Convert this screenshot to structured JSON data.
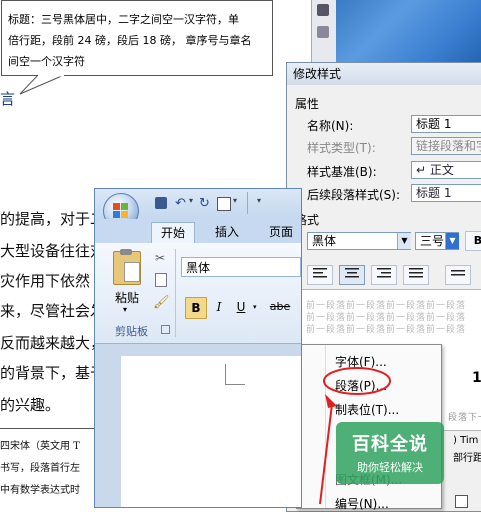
{
  "callout": {
    "line1": "标题：三号黑体居中，二字之间空一汉字符，单",
    "line2": "倍行距，段前 24 磅，段后 18 磅， 章序号与章名",
    "line3": "间空一个汉字符"
  },
  "document": {
    "line_a": "的提高，对于二",
    "line_b": "大型设备往往对",
    "line_c": "灾作用下依然",
    "line_d": "来，尽管社会发",
    "line_e": "反而越来越大，",
    "line_f": "的背景下，基于",
    "line_g": "的兴趣。",
    "small_1": "四宋体（英文用 T",
    "small_2": "书写，段落首行左",
    "small_3": "中有数学表达式时",
    "heading_fragment": "言"
  },
  "modify_dialog": {
    "title": "修改样式",
    "section_properties": "属性",
    "name_label": "名称(N):",
    "name_value": "标题 1",
    "type_label": "样式类型(T):",
    "type_value": "链接段落和字",
    "based_on_label": "样式基准(B):",
    "based_on_value": "↵ 正文",
    "next_label": "后续段落样式(S):",
    "next_value": "标题 1",
    "section_format": "格式",
    "font_value": "黑体",
    "size_value": "三号",
    "bold": "B",
    "preview_text": "前一段落前一段落前一段落前一段落",
    "preview_next": "段落下一",
    "preview_big": "1",
    "preview_side_1": ") Tim",
    "preview_side_2": "部行距"
  },
  "context_menu": {
    "items": [
      "字体(F)...",
      "段落(P)...",
      "制表位(T)...",
      "图文框(M)...",
      "编号(N)..."
    ],
    "highlight_color": "#e02020"
  },
  "word_app": {
    "tabs": [
      "开始",
      "插入",
      "页面"
    ],
    "font_name": "黑体",
    "paste_label": "粘贴",
    "clipboard_label": "剪贴板",
    "bold": "B",
    "italic": "I",
    "underline": "U",
    "strike": "abe"
  },
  "watermark": {
    "big": "百科全说",
    "small": "助你轻松解决",
    "color": "#28a05a"
  }
}
